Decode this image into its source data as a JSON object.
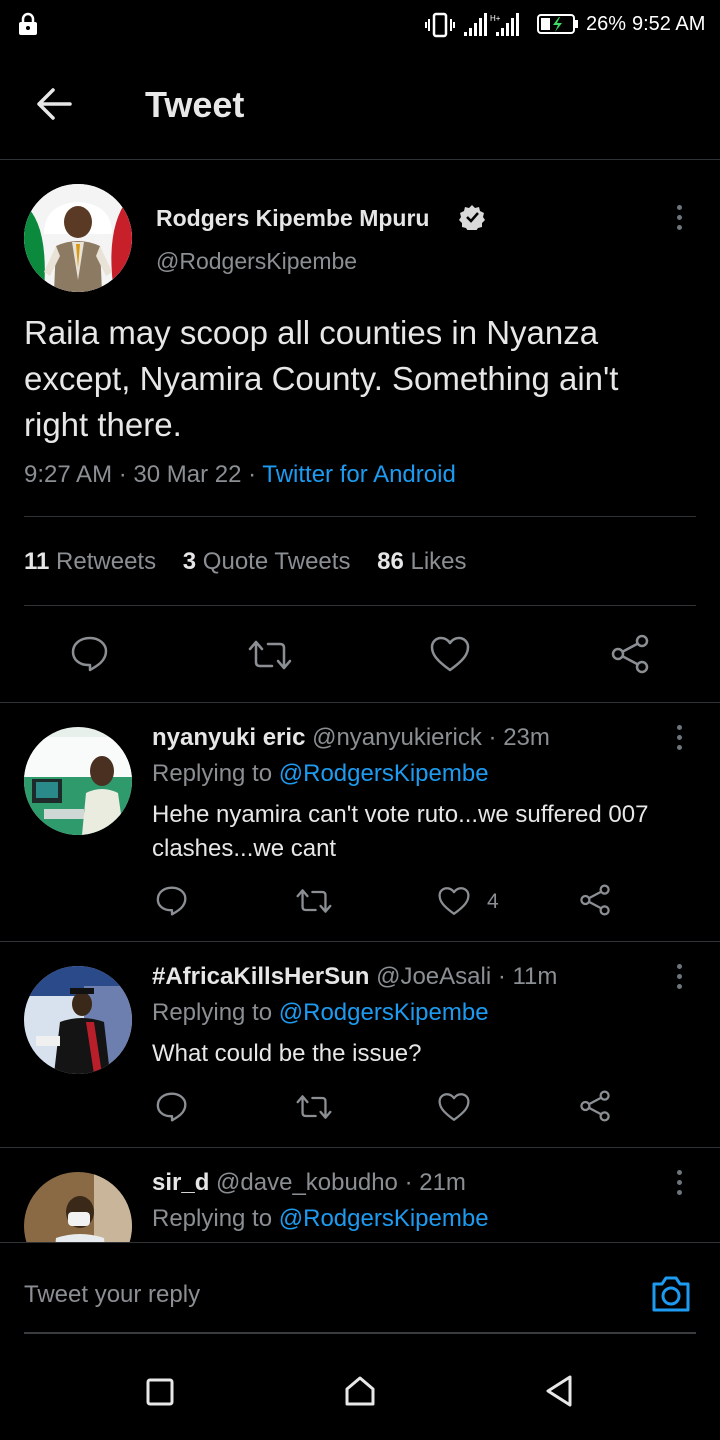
{
  "status": {
    "battery": "26%",
    "time": "9:52 AM"
  },
  "header": {
    "title": "Tweet"
  },
  "tweet": {
    "name": "Rodgers Kipembe Mpuru",
    "handle": "@RodgersKipembe",
    "text_line1": "Raila may scoop all counties in Nyanza",
    "text_line2": "except, Nyamira County. Something ain't",
    "text_line3": "right there.",
    "time": "9:27 AM",
    "date": "30 Mar 22",
    "source": "Twitter for Android",
    "sep": "·",
    "retweets_count": "11",
    "retweets_label": "Retweets",
    "quotes_count": "3",
    "quotes_label": "Quote Tweets",
    "likes_count": "86",
    "likes_label": "Likes"
  },
  "replies": [
    {
      "name": "nyanyuki eric",
      "handle": "@nyanyukierick",
      "age": "· 23m",
      "replying_label": "Replying to",
      "replying_to": "@RodgersKipembe",
      "text_line1": "Hehe nyamira can't vote ruto...we suffered 007",
      "text_line2": "clashes...we cant",
      "likes": "4"
    },
    {
      "name": "#AfricaKillsHerSun",
      "handle": "@JoeAsali",
      "age": "· 11m",
      "replying_label": "Replying to",
      "replying_to": "@RodgersKipembe",
      "text_line1": "What could be the issue?"
    },
    {
      "name": "sir_d",
      "handle": "@dave_kobudho",
      "age": "· 21m",
      "replying_label": "Replying to",
      "replying_to": "@RodgersKipembe"
    }
  ],
  "compose": {
    "placeholder": "Tweet your reply"
  },
  "colors": {
    "accent": "#1d9bf0",
    "background": "#000000",
    "divider": "#2f3336"
  }
}
